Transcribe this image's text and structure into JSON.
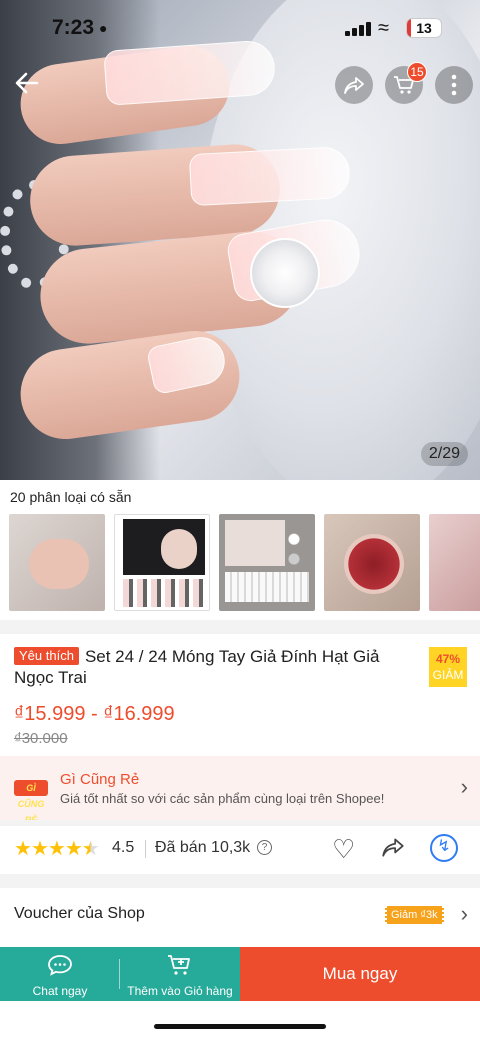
{
  "status_bar": {
    "time": "7:23",
    "battery_level": "13",
    "battery_fraction": 0.13
  },
  "header": {
    "cart_count": "15"
  },
  "gallery": {
    "counter": "2/29"
  },
  "variants": {
    "label": "20 phân loại có sẵn"
  },
  "product": {
    "badge": "Yêu thích",
    "title": "Set 24 / 24 Móng Tay Giả Đính Hạt Giả Ngọc Trai",
    "discount_percent": "47%",
    "discount_word": "GIẢM",
    "price_range": "₫15.999 - ₫16.999",
    "old_price": "₫30.000"
  },
  "promo": {
    "logo_text": "GÌ CŨNG RẺ",
    "title": "Gì Cũng Rẻ",
    "subtitle": "Giá tốt nhất so với các sản phẩm cùng loại trên Shopee!"
  },
  "stats": {
    "stars": 4.5,
    "rating": "4.5",
    "sold": "Đã bán 10,3k"
  },
  "voucher": {
    "label": "Voucher của Shop",
    "tag": "Giảm ₫3k"
  },
  "bottom_bar": {
    "chat_label": "Chat ngay",
    "cart_label": "Thêm vào Giỏ hàng",
    "buy_label": "Mua ngay"
  },
  "colors": {
    "brand": "#ee4d2d",
    "chat_green": "#26aa99",
    "star": "#ffc107",
    "discount_yellow": "#ffd424"
  }
}
